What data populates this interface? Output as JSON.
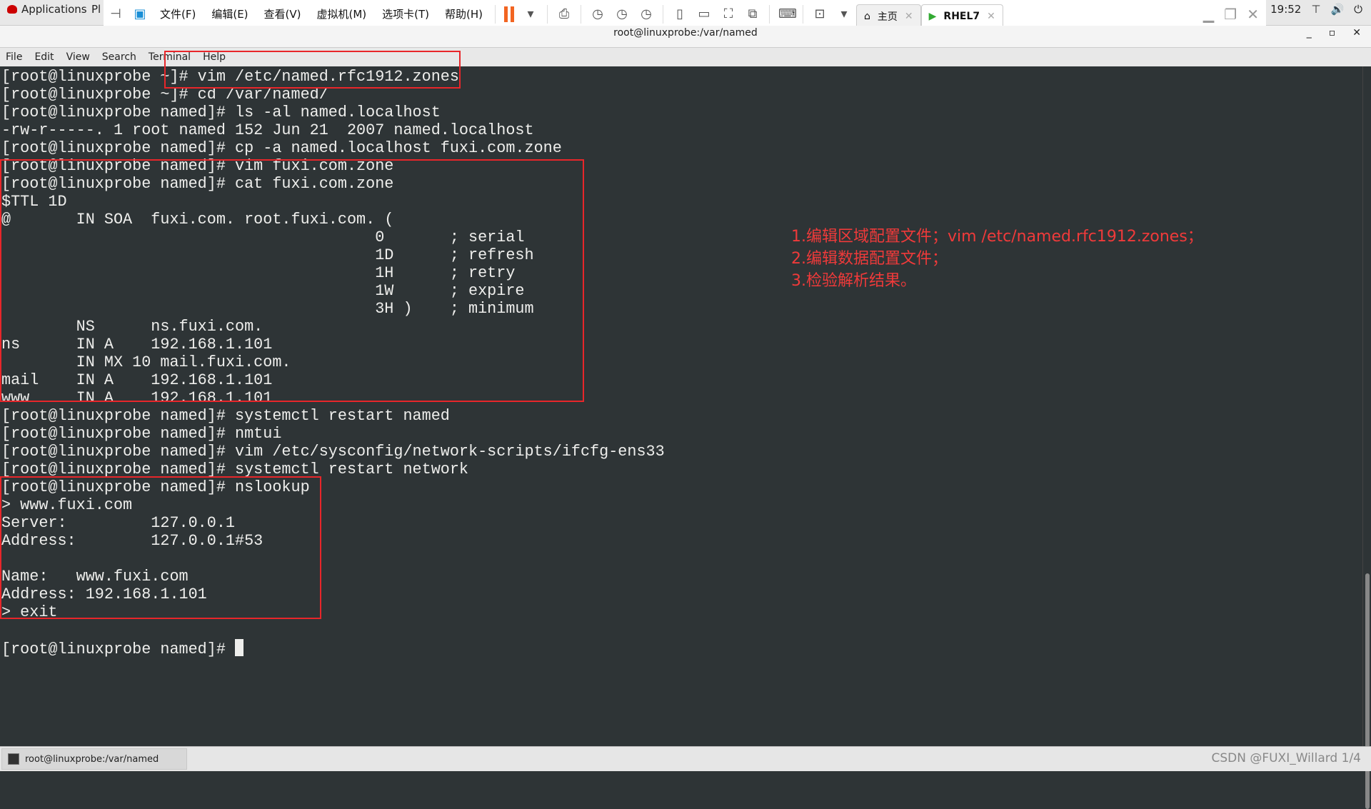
{
  "topbar": {
    "applications": "Applications",
    "places": "Pl",
    "time": "19:52"
  },
  "vmware": {
    "menus": [
      "文件(F)",
      "编辑(E)",
      "查看(V)",
      "虚拟机(M)",
      "选项卡(T)",
      "帮助(H)"
    ],
    "tabs": [
      {
        "label": "主页"
      },
      {
        "label": "RHEL7"
      }
    ]
  },
  "window": {
    "title": "root@linuxprobe:/var/named"
  },
  "menubar": [
    "File",
    "Edit",
    "View",
    "Search",
    "Terminal",
    "Help"
  ],
  "terminal": {
    "lines": [
      "[root@linuxprobe ~]# vim /etc/named.rfc1912.zones",
      "[root@linuxprobe ~]# cd /var/named/",
      "[root@linuxprobe named]# ls -al named.localhost",
      "-rw-r-----. 1 root named 152 Jun 21  2007 named.localhost",
      "[root@linuxprobe named]# cp -a named.localhost fuxi.com.zone",
      "[root@linuxprobe named]# vim fuxi.com.zone",
      "[root@linuxprobe named]# cat fuxi.com.zone",
      "$TTL 1D",
      "@       IN SOA  fuxi.com. root.fuxi.com. (",
      "                                        0       ; serial",
      "                                        1D      ; refresh",
      "                                        1H      ; retry",
      "                                        1W      ; expire",
      "                                        3H )    ; minimum",
      "        NS      ns.fuxi.com.",
      "ns      IN A    192.168.1.101",
      "        IN MX 10 mail.fuxi.com.",
      "mail    IN A    192.168.1.101",
      "www     IN A    192.168.1.101",
      "[root@linuxprobe named]# systemctl restart named",
      "[root@linuxprobe named]# nmtui",
      "[root@linuxprobe named]# vim /etc/sysconfig/network-scripts/ifcfg-ens33",
      "[root@linuxprobe named]# systemctl restart network",
      "[root@linuxprobe named]# nslookup",
      "> www.fuxi.com",
      "Server:         127.0.0.1",
      "Address:        127.0.0.1#53",
      "",
      "Name:   www.fuxi.com",
      "Address: 192.168.1.101",
      "> exit",
      "",
      "[root@linuxprobe named]# "
    ]
  },
  "annotation": [
    "1.编辑区域配置文件；vim /etc/named.rfc1912.zones；",
    "2.编辑数据配置文件；",
    "3.检验解析结果。"
  ],
  "taskbar": {
    "item": "root@linuxprobe:/var/named",
    "watermark": "CSDN @FUXI_Willard",
    "pager": "1/4"
  },
  "colors": {
    "terminal_bg": "#2e3436",
    "highlight": "#e8262a"
  }
}
